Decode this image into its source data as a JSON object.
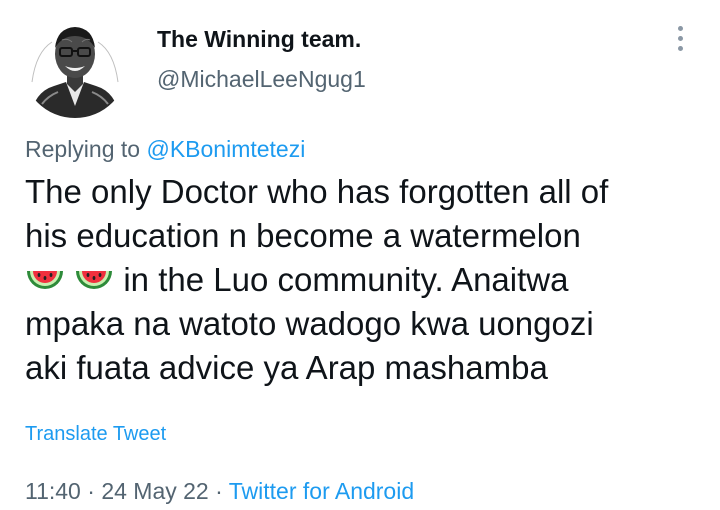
{
  "user": {
    "display_name": "The Winning team.",
    "handle": "@MichaelLeeNgug1"
  },
  "reply": {
    "prefix": "Replying to",
    "mention": "@KBonimtetezi"
  },
  "tweet": {
    "line1": "The only Doctor who has forgotten all of",
    "line2": "his education n become a watermelon",
    "line3_rest": "in the Luo community. Anaitwa",
    "line4": "mpaka na watoto wadogo kwa uongozi",
    "line5": "aki fuata advice ya Arap mashamba",
    "emoji": "watermelon"
  },
  "translate_label": "Translate Tweet",
  "meta": {
    "time": "11:40",
    "separator": "·",
    "date": "24 May 22",
    "source": "Twitter for Android"
  },
  "icons": {
    "more": "more-vertical-icon",
    "emoji": "watermelon-icon"
  },
  "colors": {
    "text": "#0f1419",
    "secondary": "#536471",
    "link": "#1d9bf0"
  }
}
